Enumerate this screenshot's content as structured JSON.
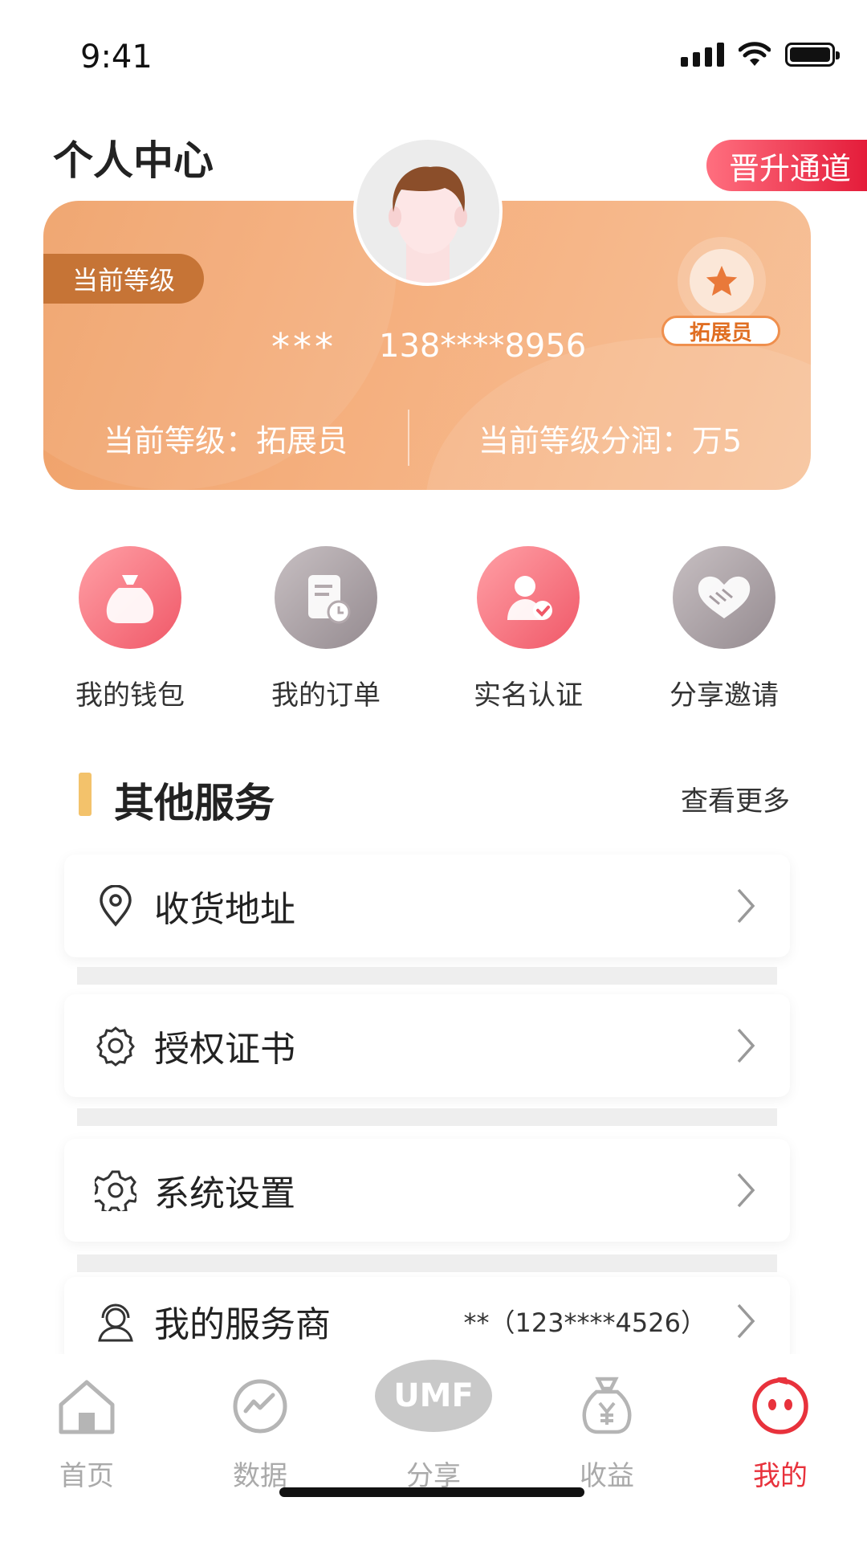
{
  "status": {
    "time": "9:41"
  },
  "header": {
    "title": "个人中心",
    "promo_label": "晋升通道"
  },
  "card": {
    "level_tag": "当前等级",
    "name": "***",
    "phone": "138****8956",
    "badge_label": "拓展员",
    "level_text": "当前等级：拓展员",
    "profit_text": "当前等级分润：万5"
  },
  "quick_actions": [
    {
      "label": "我的钱包",
      "icon": "money-bag-icon"
    },
    {
      "label": "我的订单",
      "icon": "order-document-icon"
    },
    {
      "label": "实名认证",
      "icon": "verified-user-icon"
    },
    {
      "label": "分享邀请",
      "icon": "handshake-icon"
    }
  ],
  "services": {
    "title": "其他服务",
    "more": "查看更多",
    "items": [
      {
        "label": "收货地址",
        "icon": "location-pin-icon",
        "value": ""
      },
      {
        "label": "授权证书",
        "icon": "certificate-icon",
        "value": ""
      },
      {
        "label": "系统设置",
        "icon": "gear-icon",
        "value": ""
      },
      {
        "label": "我的服务商",
        "icon": "headset-user-icon",
        "value": "**（123****4526）"
      }
    ]
  },
  "tabbar": [
    {
      "label": "首页",
      "icon": "home-icon"
    },
    {
      "label": "数据",
      "icon": "chart-icon"
    },
    {
      "label": "分享",
      "icon": "umf-share-icon",
      "logo_text": "UMF"
    },
    {
      "label": "收益",
      "icon": "yen-bag-icon"
    },
    {
      "label": "我的",
      "icon": "profile-face-icon"
    }
  ],
  "colors": {
    "accent": "#e8323c",
    "card_orange": "#f5b07f",
    "section_bar": "#f3c26b"
  }
}
